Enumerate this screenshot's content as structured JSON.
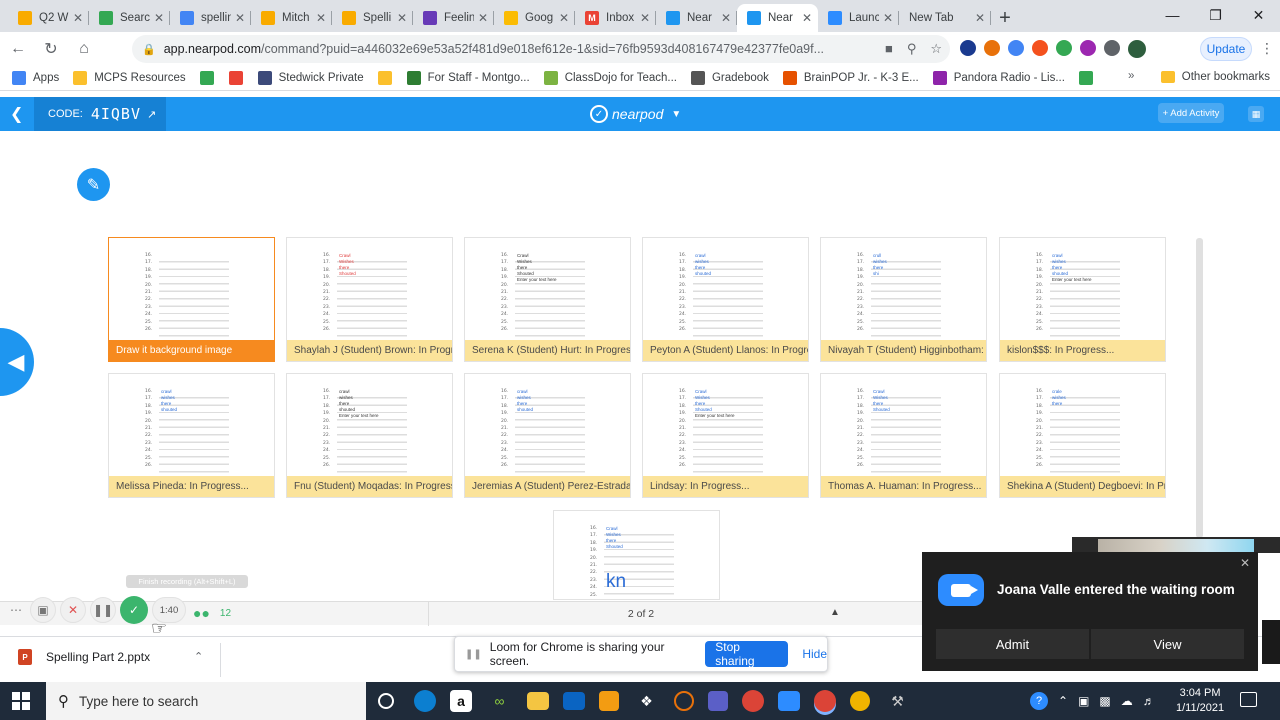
{
  "browser": {
    "tabs": [
      {
        "label": "Q2 W",
        "color": "#f9ab00",
        "glyph": ""
      },
      {
        "label": "Searc",
        "color": "#34a853",
        "glyph": ""
      },
      {
        "label": "spellin",
        "color": "#4285f4",
        "glyph": ""
      },
      {
        "label": "Mitch",
        "color": "#f9ab00",
        "glyph": ""
      },
      {
        "label": "Spelli",
        "color": "#f9ab00",
        "glyph": ""
      },
      {
        "label": "Feelin",
        "color": "#673ab7",
        "glyph": ""
      },
      {
        "label": "Goog",
        "color": "#fbbc04",
        "glyph": ""
      },
      {
        "label": "Inbox",
        "color": "#ea4335",
        "glyph": "M"
      },
      {
        "label": "Near",
        "color": "#1e96f0",
        "glyph": ""
      },
      {
        "label": "Near",
        "color": "#1e96f0",
        "glyph": "",
        "active": true
      },
      {
        "label": "Launc",
        "color": "#2d8cff",
        "glyph": ""
      },
      {
        "label": "New Tab",
        "color": "",
        "glyph": ""
      }
    ],
    "url_domain": "app.nearpod.com",
    "url_rest": "/command?puid=a446032e69e53a52f481d9e018ef612e-1&sid=76fb9593d408167479e42377fe0a9f...",
    "update_label": "Update",
    "bookmarks": [
      {
        "label": "Apps",
        "color": "#4285f4"
      },
      {
        "label": "MCPS Resources",
        "color": "#fbc02d"
      },
      {
        "label": "",
        "color": "#34a853"
      },
      {
        "label": "",
        "color": "#ea4335"
      },
      {
        "label": "Stedwick Private",
        "color": "#3c4a7a"
      },
      {
        "label": "",
        "color": "#fbc02d"
      },
      {
        "label": "For Staff - Montgo...",
        "color": "#2e7d32"
      },
      {
        "label": "ClassDojo for Teach...",
        "color": "#7cb342"
      },
      {
        "label": "Gradebook",
        "color": "#555555"
      },
      {
        "label": "BrainPOP Jr. - K-3 E...",
        "color": "#e65100"
      },
      {
        "label": "Pandora Radio - Lis...",
        "color": "#8e24aa"
      },
      {
        "label": "",
        "color": "#34a853"
      }
    ],
    "other_bookmarks": "Other bookmarks"
  },
  "nearpod": {
    "code_label": "CODE:",
    "code_value": "4IQBV",
    "logo_text": "nearpod",
    "add_activity": "+ Add Activity",
    "pager": "2 of 2",
    "student_count": "12",
    "cards": [
      {
        "caption": "Draw it background image",
        "words": [],
        "selected": true
      },
      {
        "caption": "Shaylah J (Student) Brown: In Progress...",
        "words": [
          {
            "t": "Crawl",
            "c": "red"
          },
          {
            "t": "Wishes",
            "c": "red"
          },
          {
            "t": "there",
            "c": "red"
          },
          {
            "t": "Shouted",
            "c": "red"
          }
        ]
      },
      {
        "caption": "Serena K (Student) Hurt: In Progress...",
        "words": [
          {
            "t": "Crawl",
            "c": "dark"
          },
          {
            "t": "Wishes",
            "c": "dark"
          },
          {
            "t": "there",
            "c": "dark"
          },
          {
            "t": "Shouted",
            "c": "dark"
          },
          {
            "t": "Enter your text here",
            "c": "dark"
          }
        ]
      },
      {
        "caption": "Peyton A (Student) Llanos: In Progress...",
        "words": [
          {
            "t": "crawl",
            "c": "blue"
          },
          {
            "t": "wishes",
            "c": "blue"
          },
          {
            "t": "there",
            "c": "blue"
          },
          {
            "t": "shouted",
            "c": "blue"
          }
        ]
      },
      {
        "caption": "Nivayah T (Student) Higginbotham: In Progress...",
        "words": [
          {
            "t": "crull",
            "c": "blue"
          },
          {
            "t": "wishes",
            "c": "blue"
          },
          {
            "t": "there",
            "c": "blue"
          },
          {
            "t": "shi",
            "c": "blue"
          }
        ]
      },
      {
        "caption": "kislon$$$: In Progress...",
        "words": [
          {
            "t": "crawl",
            "c": "blue"
          },
          {
            "t": "wishes",
            "c": "blue"
          },
          {
            "t": "there",
            "c": "blue"
          },
          {
            "t": "shouted",
            "c": "blue"
          },
          {
            "t": "Enter your text here",
            "c": "dark"
          }
        ]
      },
      {
        "caption": "Melissa Pineda: In Progress...",
        "words": [
          {
            "t": "crawl",
            "c": "blue"
          },
          {
            "t": "wishes",
            "c": "blue"
          },
          {
            "t": "there",
            "c": "blue"
          },
          {
            "t": "shouted",
            "c": "blue"
          }
        ]
      },
      {
        "caption": "Fnu (Student) Moqadas: In Progress...",
        "words": [
          {
            "t": "crawl",
            "c": "dark"
          },
          {
            "t": "wishes",
            "c": "dark"
          },
          {
            "t": "there",
            "c": "dark"
          },
          {
            "t": "shouted",
            "c": "dark"
          },
          {
            "t": "Enter your text here",
            "c": "dark"
          }
        ]
      },
      {
        "caption": "Jeremias A (Student) Perez-Estrada: In Progress...",
        "words": [
          {
            "t": "crawl",
            "c": "blue"
          },
          {
            "t": "wishes",
            "c": "blue"
          },
          {
            "t": "there",
            "c": "blue"
          },
          {
            "t": "shouted",
            "c": "blue"
          }
        ]
      },
      {
        "caption": "Lindsay: In Progress...",
        "words": [
          {
            "t": "Crawl",
            "c": "blue"
          },
          {
            "t": "Wishes",
            "c": "blue"
          },
          {
            "t": "there",
            "c": "blue"
          },
          {
            "t": "Shouted",
            "c": "blue"
          },
          {
            "t": "Enter your text here",
            "c": "dark"
          }
        ]
      },
      {
        "caption": "Thomas A. Huaman: In Progress...",
        "words": [
          {
            "t": "Crawl",
            "c": "blue"
          },
          {
            "t": "Wishes",
            "c": "blue"
          },
          {
            "t": "there",
            "c": "blue"
          },
          {
            "t": "Shouted",
            "c": "blue"
          }
        ]
      },
      {
        "caption": "Shekina A (Student) Degboevi: In Progress...",
        "words": [
          {
            "t": "crale",
            "c": "blue"
          },
          {
            "t": "wishes",
            "c": "blue"
          },
          {
            "t": "there",
            "c": "blue"
          }
        ]
      },
      {
        "caption": "",
        "words": [
          {
            "t": "Crawl",
            "c": "blue"
          },
          {
            "t": "Wishes",
            "c": "blue"
          },
          {
            "t": "there",
            "c": "blue"
          },
          {
            "t": "Shouted",
            "c": "blue"
          }
        ],
        "big": "kn"
      }
    ]
  },
  "loom": {
    "tooltip": "Finish recording (Alt+Shift+L)",
    "timer": "1:40",
    "sharing_text": "Loom for Chrome is sharing your screen.",
    "stop_sharing": "Stop sharing",
    "hide": "Hide"
  },
  "downloads": {
    "file": "Spelling Part 2.pptx"
  },
  "zoom": {
    "message": "Joana Valle entered the waiting room",
    "admit": "Admit",
    "view": "View"
  },
  "taskbar": {
    "search_placeholder": "Type here to search",
    "time": "3:04 PM",
    "date": "1/11/2021"
  },
  "worksheet_numbers": [
    "16.",
    "17.",
    "18.",
    "19.",
    "20.",
    "21.",
    "22.",
    "23.",
    "24.",
    "25.",
    "26."
  ]
}
